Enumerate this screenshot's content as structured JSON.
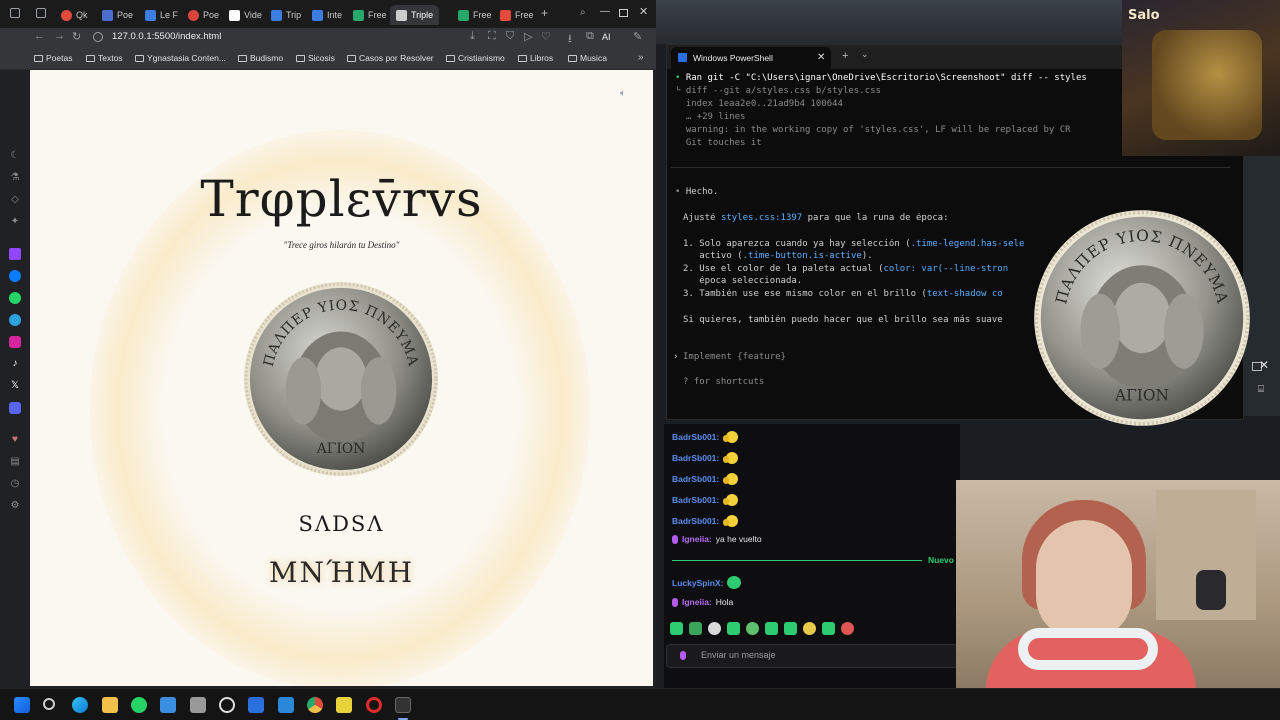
{
  "browser": {
    "tabs": [
      {
        "label": "Qk",
        "color": "#e24b3b"
      },
      {
        "label": "Poe",
        "color": "#4a6fd1"
      },
      {
        "label": "Le F",
        "color": "#3b7de0"
      },
      {
        "label": "Poe",
        "color": "#d9443a"
      },
      {
        "label": "Vide",
        "color": "#ffffff"
      },
      {
        "label": "Trip",
        "color": "#3b7de0"
      },
      {
        "label": "Inte",
        "color": "#3b7de0"
      },
      {
        "label": "Free",
        "color": "#25a869"
      },
      {
        "label": "Triple",
        "color": "#cccccc"
      },
      {
        "label": "Free",
        "color": "#25a869"
      },
      {
        "label": "Free",
        "color": "#e24b3b"
      }
    ],
    "url": "127.0.0.1:5500/index.html",
    "ai_label": "AI",
    "bookmarks": [
      "Poetas",
      "Textos",
      "Ygnastasia Conten...",
      "Budismo",
      "Sicosis",
      "Casos por Resolver",
      "Cristianismo",
      "Libros",
      "Musica"
    ]
  },
  "page": {
    "title": "Trφplεv̄rvs",
    "subtitle": "\"Trece giros hilarán tu Destino\"",
    "coin_top_text": "ΠΑΛΠΕΡ ΥΙΟΣ ΠΝΕΥΜΑ",
    "coin_bottom_text": "ΑΓΙΟΝ",
    "word1": "SΛDSΛ",
    "word2": "MNΉMH"
  },
  "terminal": {
    "tab_title": "Windows PowerShell",
    "lines": [
      {
        "bullet": "•",
        "text": "Ran git -C \"C:\\Users\\ignar\\OneDrive\\Escritorio\\Screenshoot\" diff -- styles"
      },
      {
        "bullet": "",
        "text": "└ diff --git a/styles.css b/styles.css"
      },
      {
        "bullet": "",
        "text": "  index 1eaa2e0..21ad9b4 100644"
      },
      {
        "bullet": "",
        "text": "  … +29 lines"
      },
      {
        "bullet": "",
        "text": "  warning: in the working copy of 'styles.css', LF will be replaced by CR"
      },
      {
        "bullet": "",
        "text": "  Git touches it"
      }
    ],
    "done": "Hecho.",
    "adjust_prefix": "Ajusté ",
    "adjust_link": "styles.css:1397",
    "adjust_suffix": " para que la runa de época:",
    "item1_a": "1. Solo aparezca cuando ya hay selección (",
    "item1_code": ".time-legend.has-sele",
    "item1_b": "   activo (",
    "item1_code2": ".time-button.is-active",
    "item1_c": ").",
    "item2_a": "2. Use el color de la paleta actual (",
    "item2_code": "color: var(--line-stron",
    "item2_b": "   época seleccionada.",
    "item3_a": "3. También use ese mismo color en el brillo (",
    "item3_code": "text-shadow co",
    "closing": "Si quieres, también puedo hacer que el brillo sea más suave",
    "prompt_placeholder": "Implement {feature}",
    "shortcuts": "? for shortcuts"
  },
  "overlay": {
    "thumb_label": "Salo",
    "coin_top_text": "ΠΑΛΠΕΡ ΥΙΟΣ ΠΝΕΥΜΑ",
    "coin_bottom_text": "ΑΓΙΟΝ"
  },
  "chat": {
    "messages": [
      {
        "user": "BadrSb001:",
        "color": "#5b8def",
        "text": "",
        "emote": true
      },
      {
        "user": "BadrSb001:",
        "color": "#5b8def",
        "text": "",
        "emote": true
      },
      {
        "user": "BadrSb001:",
        "color": "#5b8def",
        "text": "",
        "emote": true
      },
      {
        "user": "BadrSb001:",
        "color": "#5b8def",
        "text": "",
        "emote": true
      },
      {
        "user": "BadrSb001:",
        "color": "#5b8def",
        "text": "",
        "emote": true
      },
      {
        "user": "Igneiia:",
        "color": "#b96cf5",
        "text": "ya he vuelto",
        "emote": false,
        "mic": true
      }
    ],
    "new_label": "Nuevo",
    "after": [
      {
        "user": "LuckySpinX:",
        "color": "#5b8def",
        "text": "",
        "emote": true
      },
      {
        "user": "Igneiia:",
        "color": "#b96cf5",
        "text": "Hola",
        "emote": false,
        "mic": true
      }
    ],
    "input_placeholder": "Enviar un mensaje"
  },
  "taskbar": {
    "icons": [
      "windows-start-icon",
      "search-icon",
      "edge-icon",
      "file-explorer-icon",
      "whatsapp-icon",
      "store-icon",
      "app-icon",
      "chatgpt-icon",
      "powershell-icon",
      "vscode-icon",
      "chrome-icon",
      "notes-icon",
      "opera-icon",
      "terminal-icon"
    ]
  }
}
